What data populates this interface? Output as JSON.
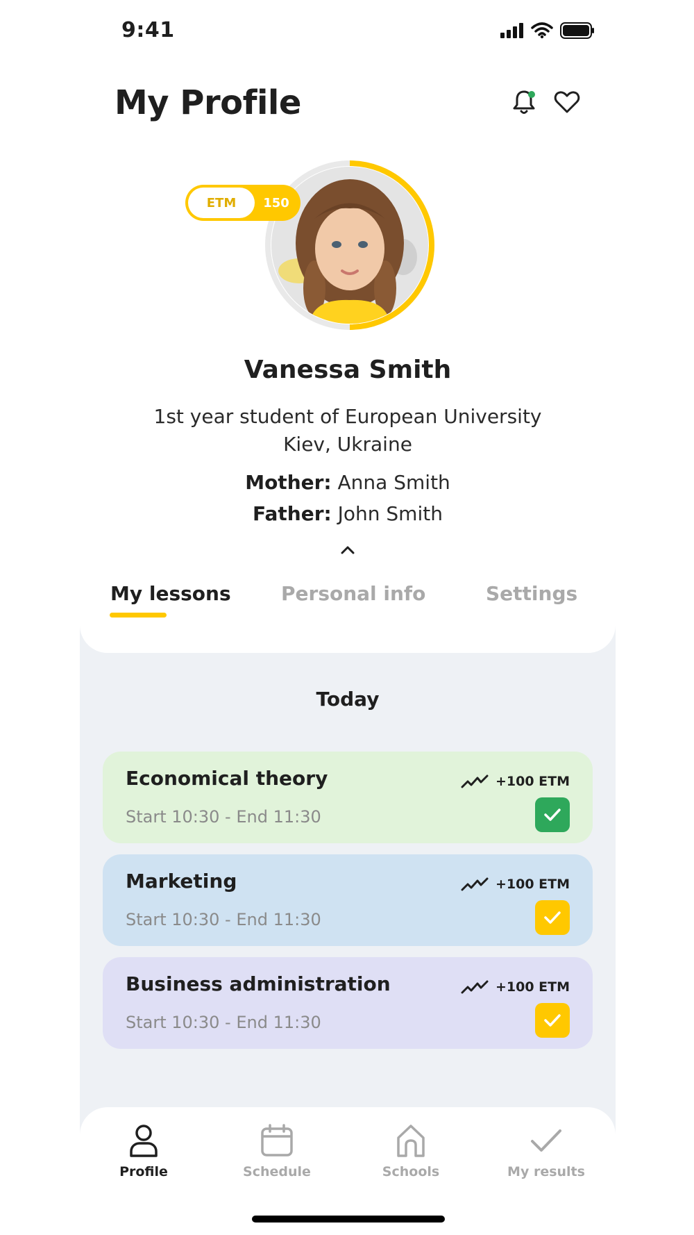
{
  "status_bar": {
    "time": "9:41"
  },
  "header": {
    "title": "My Profile"
  },
  "profile": {
    "badge_label": "ETM",
    "badge_points": "150",
    "name": "Vanessa Smith",
    "subtitle_line1": "1st year student of European University",
    "subtitle_line2": "Kiev, Ukraine",
    "mother_label": "Mother:",
    "mother_name": "Anna Smith",
    "father_label": "Father:",
    "father_name": "John Smith"
  },
  "tabs": [
    {
      "label": "My lessons",
      "active": true
    },
    {
      "label": "Personal info",
      "active": false
    },
    {
      "label": "Settings",
      "active": false
    }
  ],
  "lessons": {
    "heading": "Today",
    "items": [
      {
        "title": "Economical theory",
        "time": "Start 10:30 - End 11:30",
        "points": "+100 ETM",
        "bg": "#e1f3da",
        "check_color": "#2ea85b"
      },
      {
        "title": "Marketing",
        "time": "Start 10:30 - End 11:30",
        "points": "+100 ETM",
        "bg": "#cfe2f2",
        "check_color": "#ffc800"
      },
      {
        "title": "Business administration",
        "time": "Start 10:30 - End 11:30",
        "points": "+100 ETM",
        "bg": "#dfdff5",
        "check_color": "#ffc800"
      }
    ]
  },
  "bottom_nav": [
    {
      "label": "Profile",
      "icon": "user-icon",
      "active": true
    },
    {
      "label": "Schedule",
      "icon": "calendar-icon",
      "active": false
    },
    {
      "label": "Schools",
      "icon": "home-icon",
      "active": false
    },
    {
      "label": "My results",
      "icon": "check-icon",
      "active": false
    }
  ],
  "colors": {
    "accent": "#ffc800",
    "success": "#2ea85b",
    "muted": "#a9a9a9"
  }
}
